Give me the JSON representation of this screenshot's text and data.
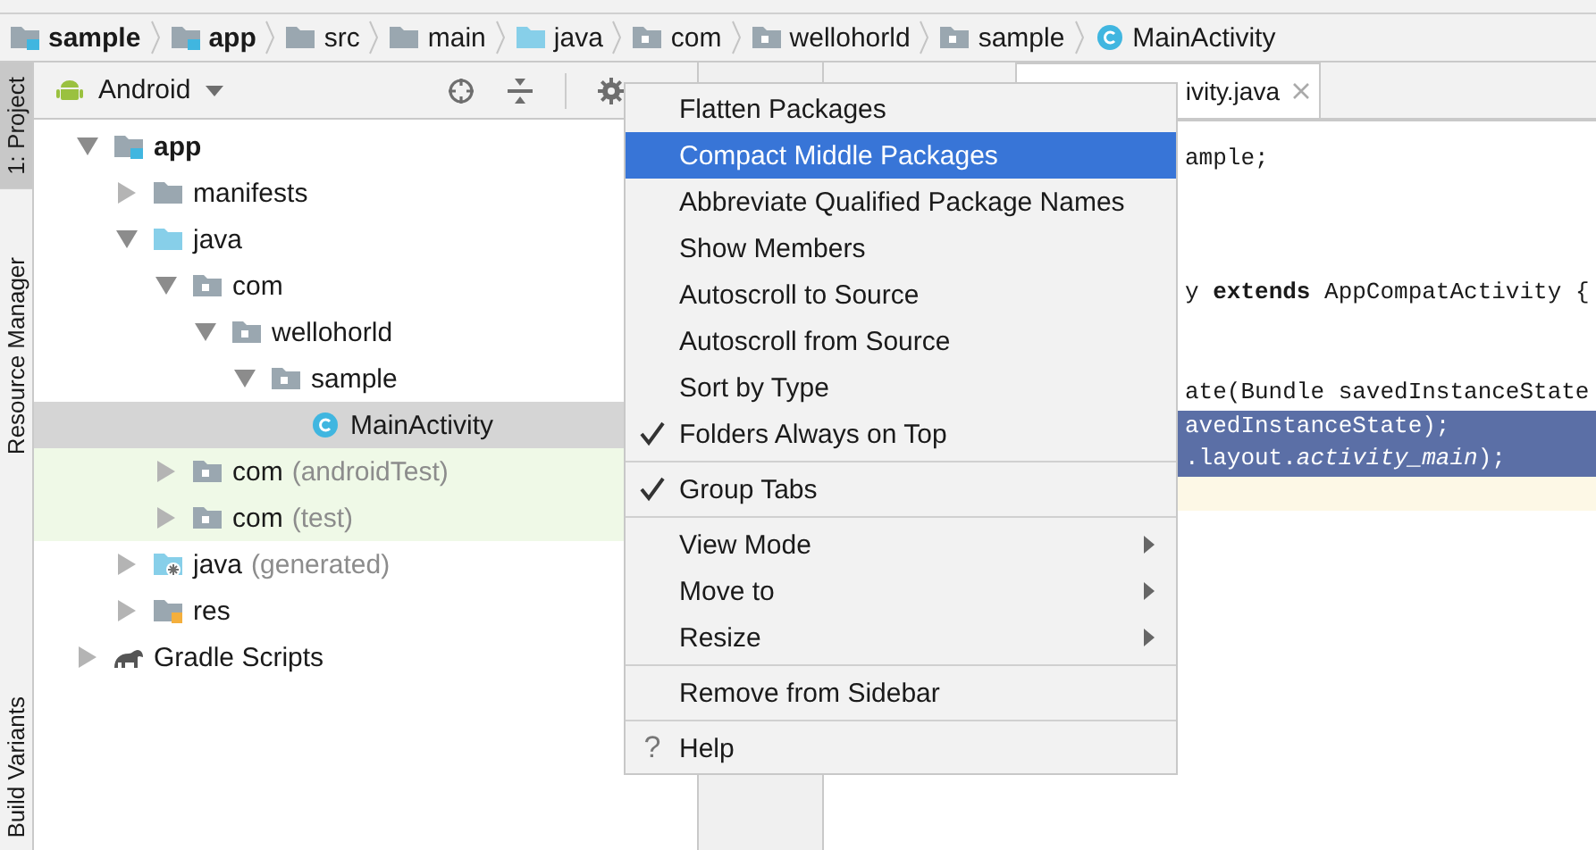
{
  "breadcrumb": [
    {
      "label": "sample",
      "kind": "module"
    },
    {
      "label": "app",
      "kind": "module"
    },
    {
      "label": "src",
      "kind": "folder"
    },
    {
      "label": "main",
      "kind": "folder"
    },
    {
      "label": "java",
      "kind": "source"
    },
    {
      "label": "com",
      "kind": "package"
    },
    {
      "label": "wellohorld",
      "kind": "package"
    },
    {
      "label": "sample",
      "kind": "package"
    },
    {
      "label": "MainActivity",
      "kind": "class"
    }
  ],
  "side_tabs": [
    {
      "label": "1: Project",
      "selected": true
    },
    {
      "label": "Resource Manager",
      "selected": false
    },
    {
      "label": "Build Variants",
      "selected": false
    }
  ],
  "project_panel": {
    "view": "Android"
  },
  "tree": [
    {
      "label": "app",
      "kind": "module",
      "expanded": true,
      "selected": false,
      "test": false,
      "children": [
        {
          "label": "manifests",
          "kind": "folder",
          "expanded": false,
          "selected": false,
          "test": false
        },
        {
          "label": "java",
          "kind": "source",
          "expanded": true,
          "selected": false,
          "test": false,
          "children": [
            {
              "label": "com",
              "kind": "package",
              "expanded": true,
              "selected": false,
              "test": false,
              "children": [
                {
                  "label": "wellohorld",
                  "kind": "package",
                  "expanded": true,
                  "selected": false,
                  "test": false,
                  "children": [
                    {
                      "label": "sample",
                      "kind": "package",
                      "expanded": true,
                      "selected": false,
                      "test": false,
                      "children": [
                        {
                          "label": "MainActivity",
                          "kind": "class",
                          "selected": true,
                          "test": false
                        }
                      ]
                    }
                  ]
                }
              ]
            },
            {
              "label": "com",
              "note": "(androidTest)",
              "kind": "package",
              "expanded": false,
              "selected": false,
              "test": true
            },
            {
              "label": "com",
              "note": "(test)",
              "kind": "package",
              "expanded": false,
              "selected": false,
              "test": true
            }
          ]
        },
        {
          "label": "java",
          "note": "(generated)",
          "kind": "generated",
          "expanded": false,
          "selected": false,
          "test": false
        },
        {
          "label": "res",
          "kind": "res",
          "expanded": false,
          "selected": false,
          "test": false
        }
      ]
    },
    {
      "label": "Gradle Scripts",
      "kind": "gradle",
      "expanded": false,
      "selected": false,
      "test": false
    }
  ],
  "editor": {
    "tab": "ivity.java",
    "lines": [
      {
        "kind": "code",
        "text": "ample;",
        "highlighted": false
      },
      {
        "kind": "blank"
      },
      {
        "kind": "blank"
      },
      {
        "kind": "blank"
      },
      {
        "kind": "code",
        "text": "y **extends** AppCompatActivity {",
        "highlighted": false
      },
      {
        "kind": "blank"
      },
      {
        "kind": "blank"
      },
      {
        "kind": "code",
        "text": "ate(Bundle savedInstanceState",
        "highlighted": false
      },
      {
        "kind": "code",
        "text": "avedInstanceState);",
        "highlighted": true
      },
      {
        "kind": "code",
        "text": ".layout.*activity_main*);",
        "highlighted": true
      },
      {
        "kind": "caret"
      }
    ]
  },
  "menu": {
    "groups": [
      [
        {
          "label": "Flatten Packages",
          "checked": false,
          "selected": false,
          "submenu": false
        },
        {
          "label": "Compact Middle Packages",
          "checked": false,
          "selected": true,
          "submenu": false
        },
        {
          "label": "Abbreviate Qualified Package Names",
          "checked": false,
          "selected": false,
          "submenu": false
        },
        {
          "label": "Show Members",
          "checked": false,
          "selected": false,
          "submenu": false
        },
        {
          "label": "Autoscroll to Source",
          "checked": false,
          "selected": false,
          "submenu": false
        },
        {
          "label": "Autoscroll from Source",
          "checked": false,
          "selected": false,
          "submenu": false
        },
        {
          "label": "Sort by Type",
          "checked": false,
          "selected": false,
          "submenu": false
        },
        {
          "label": "Folders Always on Top",
          "checked": true,
          "selected": false,
          "submenu": false
        }
      ],
      [
        {
          "label": "Group Tabs",
          "checked": true,
          "selected": false,
          "submenu": false
        }
      ],
      [
        {
          "label": "View Mode",
          "checked": false,
          "selected": false,
          "submenu": true
        },
        {
          "label": "Move to",
          "checked": false,
          "selected": false,
          "submenu": true
        },
        {
          "label": "Resize",
          "checked": false,
          "selected": false,
          "submenu": true
        }
      ],
      [
        {
          "label": "Remove from Sidebar",
          "checked": false,
          "selected": false,
          "submenu": false
        }
      ],
      [
        {
          "label": "Help",
          "icon": "?",
          "checked": false,
          "selected": false,
          "submenu": false
        }
      ]
    ]
  }
}
